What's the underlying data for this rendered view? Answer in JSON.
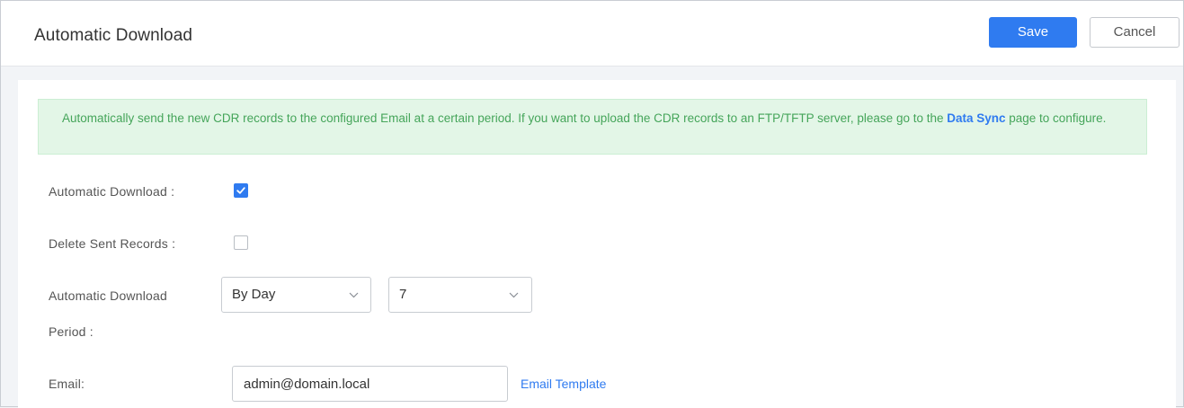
{
  "header": {
    "title": "Automatic Download",
    "save_label": "Save",
    "cancel_label": "Cancel"
  },
  "notice": {
    "text_before": "Automatically send the new CDR records to the configured Email at a certain period. If you want to upload the CDR records to an FTP/TFTP server, please go to the ",
    "link_label": "Data Sync",
    "text_after": " page to configure."
  },
  "form": {
    "auto_download": {
      "label": "Automatic Download :",
      "checked": true
    },
    "delete_sent": {
      "label": "Delete Sent Records :",
      "checked": false
    },
    "period": {
      "label_line1": "Automatic Download",
      "label_line2": "Period :",
      "unit_value": "By Day",
      "count_value": "7"
    },
    "email": {
      "label": "Email:",
      "value": "admin@domain.local",
      "template_link": "Email Template"
    }
  },
  "colors": {
    "accent": "#2f7bf0",
    "notice_bg": "#e3f6e7",
    "notice_text": "#45a55a"
  },
  "icons": {
    "check": "checkmark-icon",
    "dropdown": "chevron-down-icon"
  }
}
